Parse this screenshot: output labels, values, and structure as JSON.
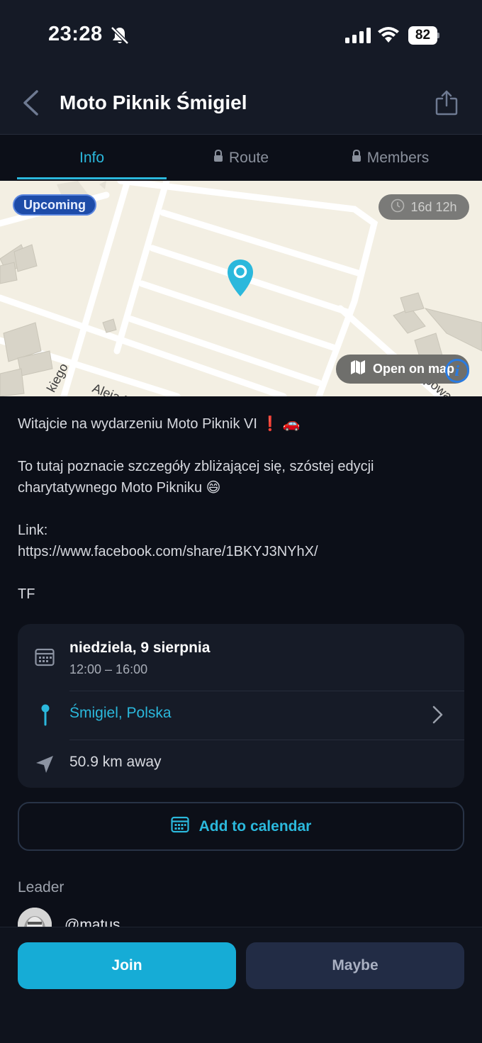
{
  "status_bar": {
    "time": "23:28",
    "battery_percent": "82",
    "icons": [
      "bell-slash-icon",
      "cellular-signal-icon",
      "wifi-icon",
      "battery-icon"
    ]
  },
  "header": {
    "title": "Moto Piknik Śmigiel",
    "icons": [
      "chevron-left-icon",
      "share-icon"
    ]
  },
  "tabs": [
    {
      "label": "Info",
      "locked": false,
      "active": true
    },
    {
      "label": "Route",
      "locked": true,
      "active": false
    },
    {
      "label": "Members",
      "locked": true,
      "active": false
    }
  ],
  "map": {
    "status_badge": "Upcoming",
    "countdown": "16d 12h",
    "open_map_label": "Open on map",
    "street_labels": [
      "kiego",
      "Aleja P",
      "Lipowa M"
    ],
    "pin_color": "#2bb8dc"
  },
  "description": {
    "line1": "Witajcie na wydarzeniu Moto Piknik VI ❗ 🚗",
    "line2": "To tutaj poznacie szczegóły zbliżającej się, szóstej edycji charytatywnego Moto Pikniku 😄",
    "link_label": "Link:",
    "link_url": "https://www.facebook.com/share/1BKYJ3NYhX/",
    "signoff": "TF"
  },
  "details": {
    "date": "niedziela, 9 sierpnia",
    "time_range": "12:00 – 16:00",
    "location": "Śmigiel, Polska",
    "distance": "50.9 km away"
  },
  "calendar_button": "Add to calendar",
  "leader": {
    "section_label": "Leader",
    "username": "@matus"
  },
  "actions": {
    "join": "Join",
    "maybe": "Maybe"
  },
  "colors": {
    "accent": "#2bb8dc",
    "background": "#0c0f18",
    "card": "#161b27",
    "upcoming_badge": "#1d4ba8"
  }
}
